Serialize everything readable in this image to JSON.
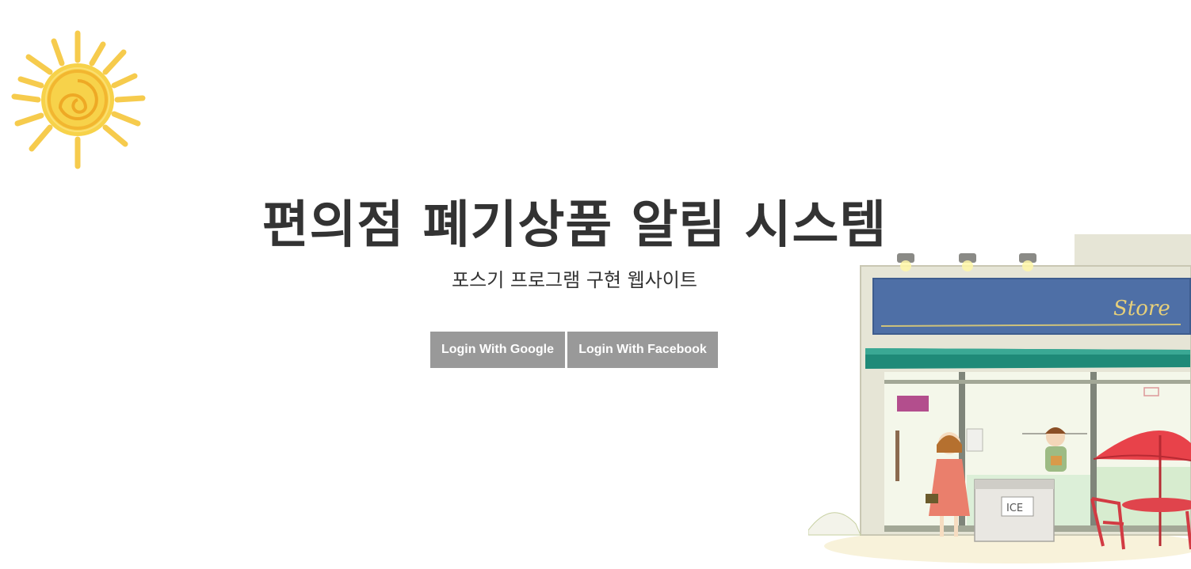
{
  "hero": {
    "title": "편의점 폐기상품 알림 시스템",
    "subtitle": "포스기 프로그램 구현 웹사이트"
  },
  "auth": {
    "google_label": "Login With Google",
    "facebook_label": "Login With Facebook"
  },
  "illustration": {
    "store_sign": "Store",
    "freezer_label": "ICE"
  },
  "colors": {
    "button_bg": "#999999",
    "button_text": "#ffffff",
    "title_text": "#333333",
    "sun_yellow": "#f5c518",
    "store_sign_blue": "#4e6fa6",
    "awning_green": "#1f8a78",
    "umbrella_red": "#e8424a"
  }
}
